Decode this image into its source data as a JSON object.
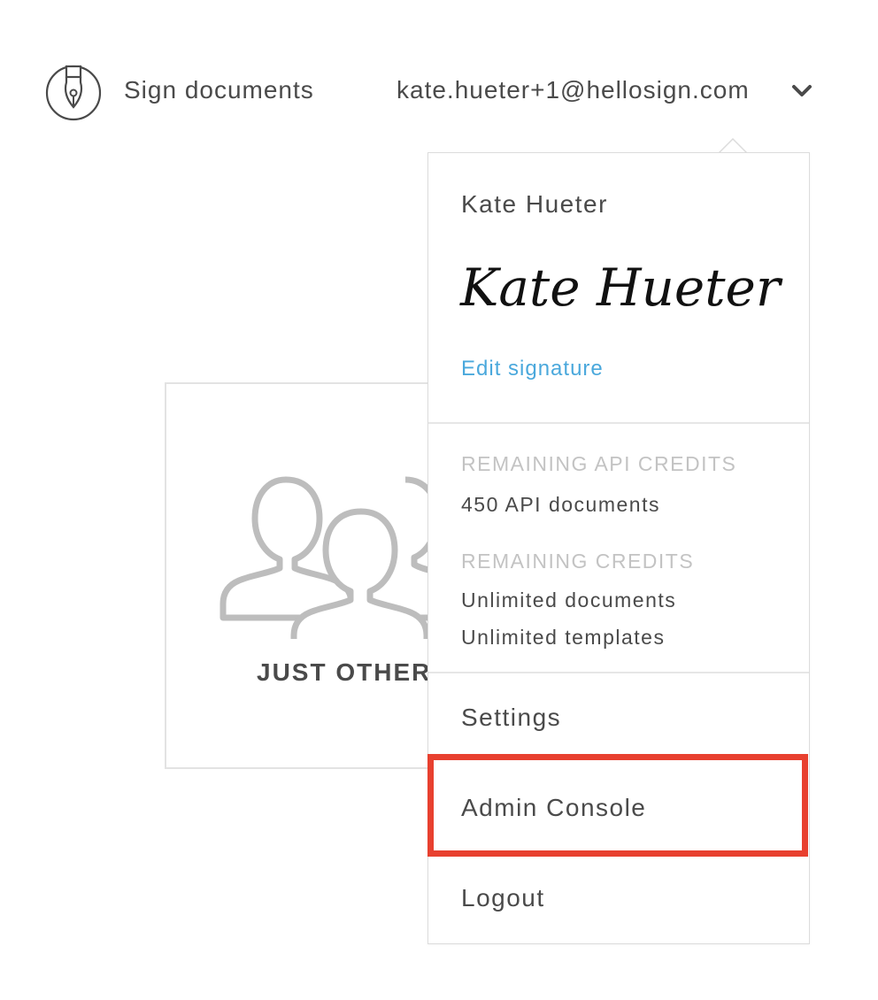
{
  "header": {
    "logo_icon": "pen-nib-icon",
    "sign_documents_label": "Sign documents",
    "account_email": "kate.hueter+1@hellosign.com",
    "dropdown_icon": "chevron-down-icon"
  },
  "card": {
    "icon": "people-group-icon",
    "label": "JUST OTHERS"
  },
  "dropdown": {
    "user_name": "Kate Hueter",
    "signature_text": "Kate Hueter",
    "edit_signature_label": "Edit signature",
    "api_credits_heading": "REMAINING API CREDITS",
    "api_credits_value": "450 API documents",
    "credits_heading": "REMAINING CREDITS",
    "credits_documents": "Unlimited documents",
    "credits_templates": "Unlimited templates",
    "settings_label": "Settings",
    "admin_console_label": "Admin Console",
    "logout_label": "Logout"
  },
  "colors": {
    "text": "#4a4a4a",
    "muted": "#c3c3c3",
    "link": "#4aa8dc",
    "highlight": "#e8402f"
  }
}
